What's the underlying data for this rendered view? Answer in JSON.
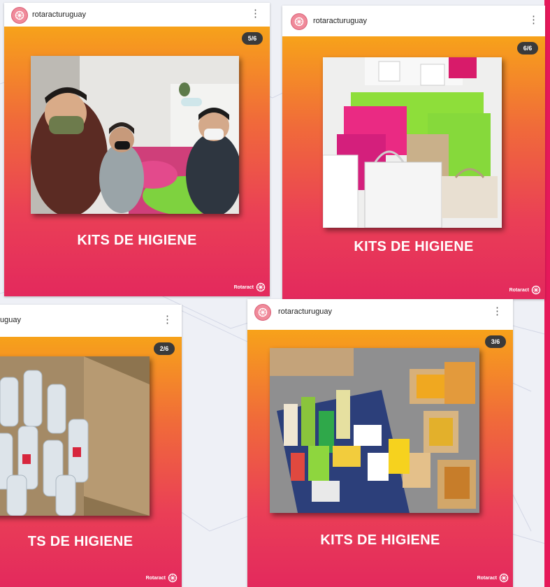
{
  "posts": [
    {
      "username": "rotaracturuguay",
      "counter": "5/6",
      "caption": "KITS DE HIGIENE",
      "brand": "Rotaract"
    },
    {
      "username": "rotaracturuguay",
      "counter": "6/6",
      "caption": "KITS DE HIGIENE",
      "brand": "Rotaract"
    },
    {
      "username": "uguay",
      "counter": "2/6",
      "caption": "TS DE HIGIENE",
      "brand": "Rotaract"
    },
    {
      "username": "rotaracturuguay",
      "counter": "3/6",
      "caption": "KITS DE HIGIENE",
      "brand": "Rotaract"
    }
  ],
  "colors": {
    "gradient_top": "#f7a21a",
    "gradient_bottom": "#e3295d",
    "accent_pink": "#e6195a",
    "counter_bg": "#3a3a3a"
  }
}
